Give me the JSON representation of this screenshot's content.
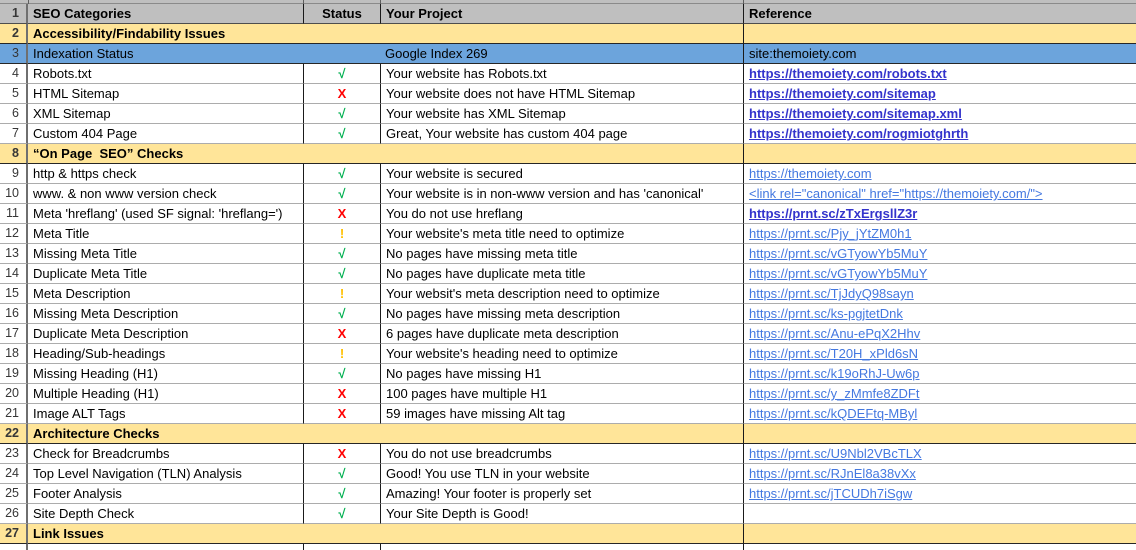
{
  "app": "spreadsheet-seo-audit",
  "colors": {
    "header_fill": "#bfbfbf",
    "section_fill": "#ffe599",
    "highlight_fill": "#6ca4dc",
    "status_check": "#00b050",
    "status_cross": "#ff0000",
    "status_warn": "#ffc000",
    "link_fresh": "#4478e0",
    "link_visited": "#3333cc"
  },
  "status_glyphs": {
    "check": "√",
    "cross": "X",
    "warn": "!"
  },
  "column_headers": [
    "SEO Categories",
    "Status",
    "Your Project",
    "Reference"
  ],
  "rows": [
    {
      "n": 1,
      "type": "header"
    },
    {
      "n": 2,
      "type": "section",
      "label": "Accessibility/Findability Issues"
    },
    {
      "n": 3,
      "type": "highlight",
      "category": "Indexation Status",
      "project": "Google Index 269",
      "reference": "site:themoiety.com"
    },
    {
      "n": 4,
      "type": "data",
      "category": "Robots.txt",
      "status": "check",
      "project": "Your website has Robots.txt",
      "ref": "https://themoiety.com/robots.txt",
      "ref_variant": "visited"
    },
    {
      "n": 5,
      "type": "data",
      "category": "HTML Sitemap",
      "status": "cross",
      "project": "Your website does not have HTML Sitemap",
      "ref": "https://themoiety.com/sitemap",
      "ref_variant": "visited"
    },
    {
      "n": 6,
      "type": "data",
      "category": "XML Sitemap",
      "status": "check",
      "project": "Your website has XML Sitemap",
      "ref": "https://themoiety.com/sitemap.xml",
      "ref_variant": "visited"
    },
    {
      "n": 7,
      "type": "data",
      "category": "Custom 404 Page",
      "status": "check",
      "project": "Great, Your website has custom 404 page",
      "ref": "https://themoiety.com/rogmiotghrth",
      "ref_variant": "visited"
    },
    {
      "n": 8,
      "type": "section",
      "label": "“On Page  SEO” Checks"
    },
    {
      "n": 9,
      "type": "data",
      "category": "http & https check",
      "status": "check",
      "project": "Your website is secured",
      "ref": "https://themoiety.com",
      "ref_variant": "fresh"
    },
    {
      "n": 10,
      "type": "data",
      "category": "www. & non www version check",
      "status": "check",
      "project": "Your website is in non-www version and has 'canonical'",
      "ref": "<link rel=\"canonical\" href=\"https://themoiety.com/\">",
      "ref_variant": "fresh"
    },
    {
      "n": 11,
      "type": "data",
      "category": "Meta 'hreflang' (used SF signal: 'hreflang=')",
      "status": "cross",
      "project": "You do not use hreflang",
      "ref": "https://prnt.sc/zTxErgsllZ3r",
      "ref_variant": "visited"
    },
    {
      "n": 12,
      "type": "data",
      "category": "Meta Title",
      "status": "warn",
      "project": "Your website's meta title need to optimize",
      "ref": "https://prnt.sc/Pjy_jYtZM0h1",
      "ref_variant": "fresh"
    },
    {
      "n": 13,
      "type": "data",
      "category": "Missing Meta Title",
      "status": "check",
      "project": "No pages have missing meta title",
      "ref": "https://prnt.sc/vGTyowYb5MuY",
      "ref_variant": "fresh"
    },
    {
      "n": 14,
      "type": "data",
      "category": "Duplicate Meta Title",
      "status": "check",
      "project": "No pages have duplicate meta title",
      "ref": "https://prnt.sc/vGTyowYb5MuY",
      "ref_variant": "fresh"
    },
    {
      "n": 15,
      "type": "data",
      "category": "Meta Description",
      "status": "warn",
      "project": "Your websit's meta description need to optimize",
      "ref": "https://prnt.sc/TjJdyQ98sayn",
      "ref_variant": "fresh"
    },
    {
      "n": 16,
      "type": "data",
      "category": "Missing Meta Description",
      "status": "check",
      "project": "No pages have missing meta description",
      "ref": "https://prnt.sc/ks-pgjtetDnk",
      "ref_variant": "fresh"
    },
    {
      "n": 17,
      "type": "data",
      "category": "Duplicate Meta Description",
      "status": "cross",
      "project": "6 pages have duplicate meta description",
      "ref": "https://prnt.sc/Anu-ePqX2Hhv",
      "ref_variant": "fresh"
    },
    {
      "n": 18,
      "type": "data",
      "category": "Heading/Sub-headings",
      "status": "warn",
      "project": "Your website's heading need to optimize",
      "ref": "https://prnt.sc/T20H_xPld6sN",
      "ref_variant": "fresh"
    },
    {
      "n": 19,
      "type": "data",
      "category": "Missing Heading (H1)",
      "status": "check",
      "project": "No pages have missing H1",
      "ref": "https://prnt.sc/k19oRhJ-Uw6p",
      "ref_variant": "fresh"
    },
    {
      "n": 20,
      "type": "data",
      "category": "Multiple Heading (H1)",
      "status": "cross",
      "project": "100 pages have multiple H1",
      "ref": "https://prnt.sc/y_zMmfe8ZDFt",
      "ref_variant": "fresh"
    },
    {
      "n": 21,
      "type": "data",
      "category": "Image ALT Tags",
      "status": "cross",
      "project": "59 images have missing Alt tag",
      "ref": "https://prnt.sc/kQDEFtq-MByl",
      "ref_variant": "fresh"
    },
    {
      "n": 22,
      "type": "section",
      "label": "Architecture Checks"
    },
    {
      "n": 23,
      "type": "data",
      "category": "Check for Breadcrumbs",
      "status": "cross",
      "project": "You do not use breadcrumbs",
      "ref": "https://prnt.sc/U9Nbl2VBcTLX",
      "ref_variant": "fresh"
    },
    {
      "n": 24,
      "type": "data",
      "category": "Top Level Navigation (TLN) Analysis",
      "status": "check",
      "project": "Good! You use TLN in your website",
      "ref": "https://prnt.sc/RJnEl8a38vXx",
      "ref_variant": "fresh"
    },
    {
      "n": 25,
      "type": "data",
      "category": "Footer Analysis",
      "status": "check",
      "project": "Amazing! Your footer is properly set",
      "ref": "https://prnt.sc/jTCUDh7iSgw",
      "ref_variant": "fresh"
    },
    {
      "n": 26,
      "type": "data",
      "category": "Site Depth Check",
      "status": "check",
      "project": "Your Site Depth is Good!",
      "ref": "",
      "ref_variant": "fresh"
    },
    {
      "n": 27,
      "type": "section",
      "label": "Link Issues"
    }
  ]
}
